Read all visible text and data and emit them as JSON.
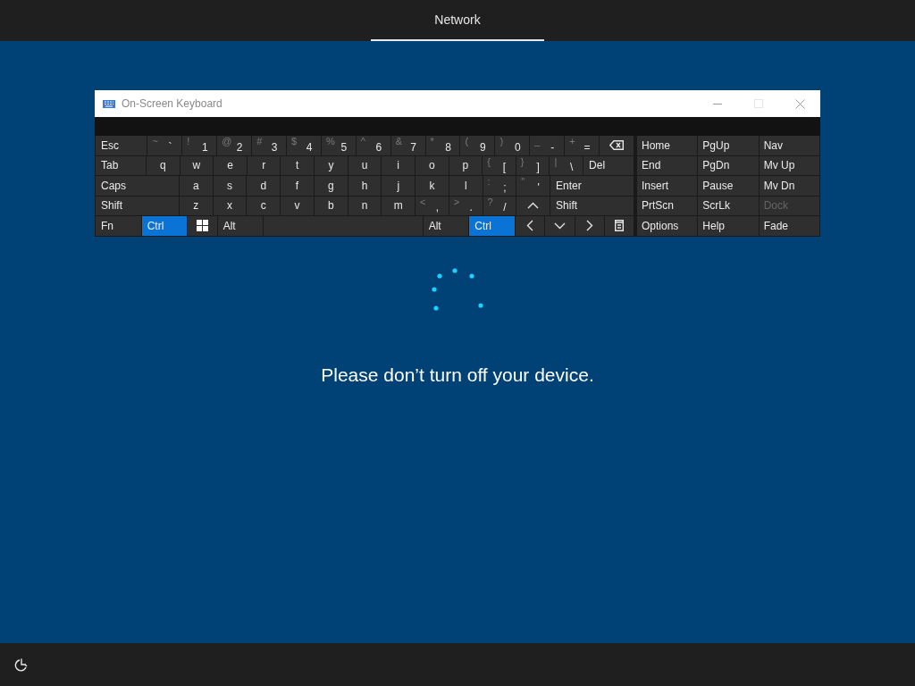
{
  "header": {
    "tabs": [
      {
        "label": "Network",
        "selected": true
      }
    ]
  },
  "keyboard_window": {
    "title": "On-Screen Keyboard",
    "maximize_disabled": true,
    "rows": [
      [
        {
          "kind": "mod",
          "label": "Esc"
        },
        {
          "kind": "char",
          "shift": "~",
          "label": "`"
        },
        {
          "kind": "char",
          "shift": "!",
          "label": "1"
        },
        {
          "kind": "char",
          "shift": "@",
          "label": "2"
        },
        {
          "kind": "char",
          "shift": "#",
          "label": "3"
        },
        {
          "kind": "char",
          "shift": "$",
          "label": "4"
        },
        {
          "kind": "char",
          "shift": "%",
          "label": "5"
        },
        {
          "kind": "char",
          "shift": "^",
          "label": "6"
        },
        {
          "kind": "char",
          "shift": "&",
          "label": "7"
        },
        {
          "kind": "char",
          "shift": "*",
          "label": "8"
        },
        {
          "kind": "char",
          "shift": "(",
          "label": "9"
        },
        {
          "kind": "char",
          "shift": ")",
          "label": "0"
        },
        {
          "kind": "char",
          "shift": "_",
          "label": "-"
        },
        {
          "kind": "char",
          "shift": "+",
          "label": "="
        },
        {
          "kind": "backspace"
        }
      ],
      [
        {
          "kind": "mod",
          "label": "Tab"
        },
        {
          "kind": "char",
          "label": "q"
        },
        {
          "kind": "char",
          "label": "w"
        },
        {
          "kind": "char",
          "label": "e"
        },
        {
          "kind": "char",
          "label": "r"
        },
        {
          "kind": "char",
          "label": "t"
        },
        {
          "kind": "char",
          "label": "y"
        },
        {
          "kind": "char",
          "label": "u"
        },
        {
          "kind": "char",
          "label": "i"
        },
        {
          "kind": "char",
          "label": "o"
        },
        {
          "kind": "char",
          "label": "p"
        },
        {
          "kind": "char",
          "shift": "{",
          "label": "["
        },
        {
          "kind": "char",
          "shift": "}",
          "label": "]"
        },
        {
          "kind": "char",
          "shift": "|",
          "label": "\\"
        },
        {
          "kind": "mod",
          "label": "Del"
        }
      ],
      [
        {
          "kind": "wide",
          "label": "Caps"
        },
        {
          "kind": "char",
          "label": "a"
        },
        {
          "kind": "char",
          "label": "s"
        },
        {
          "kind": "char",
          "label": "d"
        },
        {
          "kind": "char",
          "label": "f"
        },
        {
          "kind": "char",
          "label": "g"
        },
        {
          "kind": "char",
          "label": "h"
        },
        {
          "kind": "char",
          "label": "j"
        },
        {
          "kind": "char",
          "label": "k"
        },
        {
          "kind": "char",
          "label": "l"
        },
        {
          "kind": "char",
          "shift": ":",
          "label": ";"
        },
        {
          "kind": "char",
          "shift": "\"",
          "label": "'"
        },
        {
          "kind": "wide",
          "label": "Enter"
        }
      ],
      [
        {
          "kind": "wide",
          "label": "Shift"
        },
        {
          "kind": "char",
          "label": "z"
        },
        {
          "kind": "char",
          "label": "x"
        },
        {
          "kind": "char",
          "label": "c"
        },
        {
          "kind": "char",
          "label": "v"
        },
        {
          "kind": "char",
          "label": "b"
        },
        {
          "kind": "char",
          "label": "n"
        },
        {
          "kind": "char",
          "label": "m"
        },
        {
          "kind": "char",
          "shift": "<",
          "label": ","
        },
        {
          "kind": "char",
          "shift": ">",
          "label": "."
        },
        {
          "kind": "char",
          "shift": "?",
          "label": "/"
        },
        {
          "kind": "up"
        },
        {
          "kind": "wide",
          "label": "Shift"
        }
      ],
      [
        {
          "kind": "mod",
          "label": "Fn",
          "on": false
        },
        {
          "kind": "mod",
          "label": "Ctrl",
          "on": true
        },
        {
          "kind": "windows"
        },
        {
          "kind": "mod",
          "label": "Alt",
          "on": false
        },
        {
          "kind": "space"
        },
        {
          "kind": "mod",
          "label": "Alt",
          "on": false
        },
        {
          "kind": "mod",
          "label": "Ctrl",
          "on": true
        },
        {
          "kind": "left"
        },
        {
          "kind": "down"
        },
        {
          "kind": "right"
        },
        {
          "kind": "menu"
        }
      ]
    ],
    "nav_keys": [
      [
        {
          "label": "Home",
          "disabled": false
        },
        {
          "label": "PgUp",
          "disabled": false
        },
        {
          "label": "Nav",
          "disabled": false
        }
      ],
      [
        {
          "label": "End",
          "disabled": false
        },
        {
          "label": "PgDn",
          "disabled": false
        },
        {
          "label": "Mv Up",
          "disabled": false
        }
      ],
      [
        {
          "label": "Insert",
          "disabled": false
        },
        {
          "label": "Pause",
          "disabled": false
        },
        {
          "label": "Mv Dn",
          "disabled": false
        }
      ],
      [
        {
          "label": "PrtScn",
          "disabled": false
        },
        {
          "label": "ScrLk",
          "disabled": false
        },
        {
          "label": "Dock",
          "disabled": true
        }
      ],
      [
        {
          "label": "Options",
          "disabled": false
        },
        {
          "label": "Help",
          "disabled": false
        },
        {
          "label": "Fade",
          "disabled": false
        }
      ]
    ]
  },
  "message": "Please don’t turn off your device."
}
